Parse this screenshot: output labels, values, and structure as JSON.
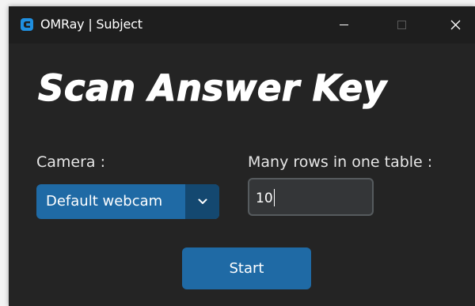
{
  "window": {
    "title": "OMRay | Subject",
    "controls": {
      "minimize": "minimize-icon",
      "maximize": "maximize-icon",
      "close": "close-icon"
    }
  },
  "main": {
    "heading": "Scan Answer Key",
    "camera_label": "Camera :",
    "camera_selected": "Default webcam",
    "rows_label": "Many rows in one table :",
    "rows_value": "10",
    "start_label": "Start"
  },
  "colors": {
    "background": "#242424",
    "titlebar": "#1e1e1e",
    "accent": "#1f6aa5",
    "accent_dark": "#144870",
    "input_bg": "#343638",
    "input_border": "#565b5e"
  }
}
